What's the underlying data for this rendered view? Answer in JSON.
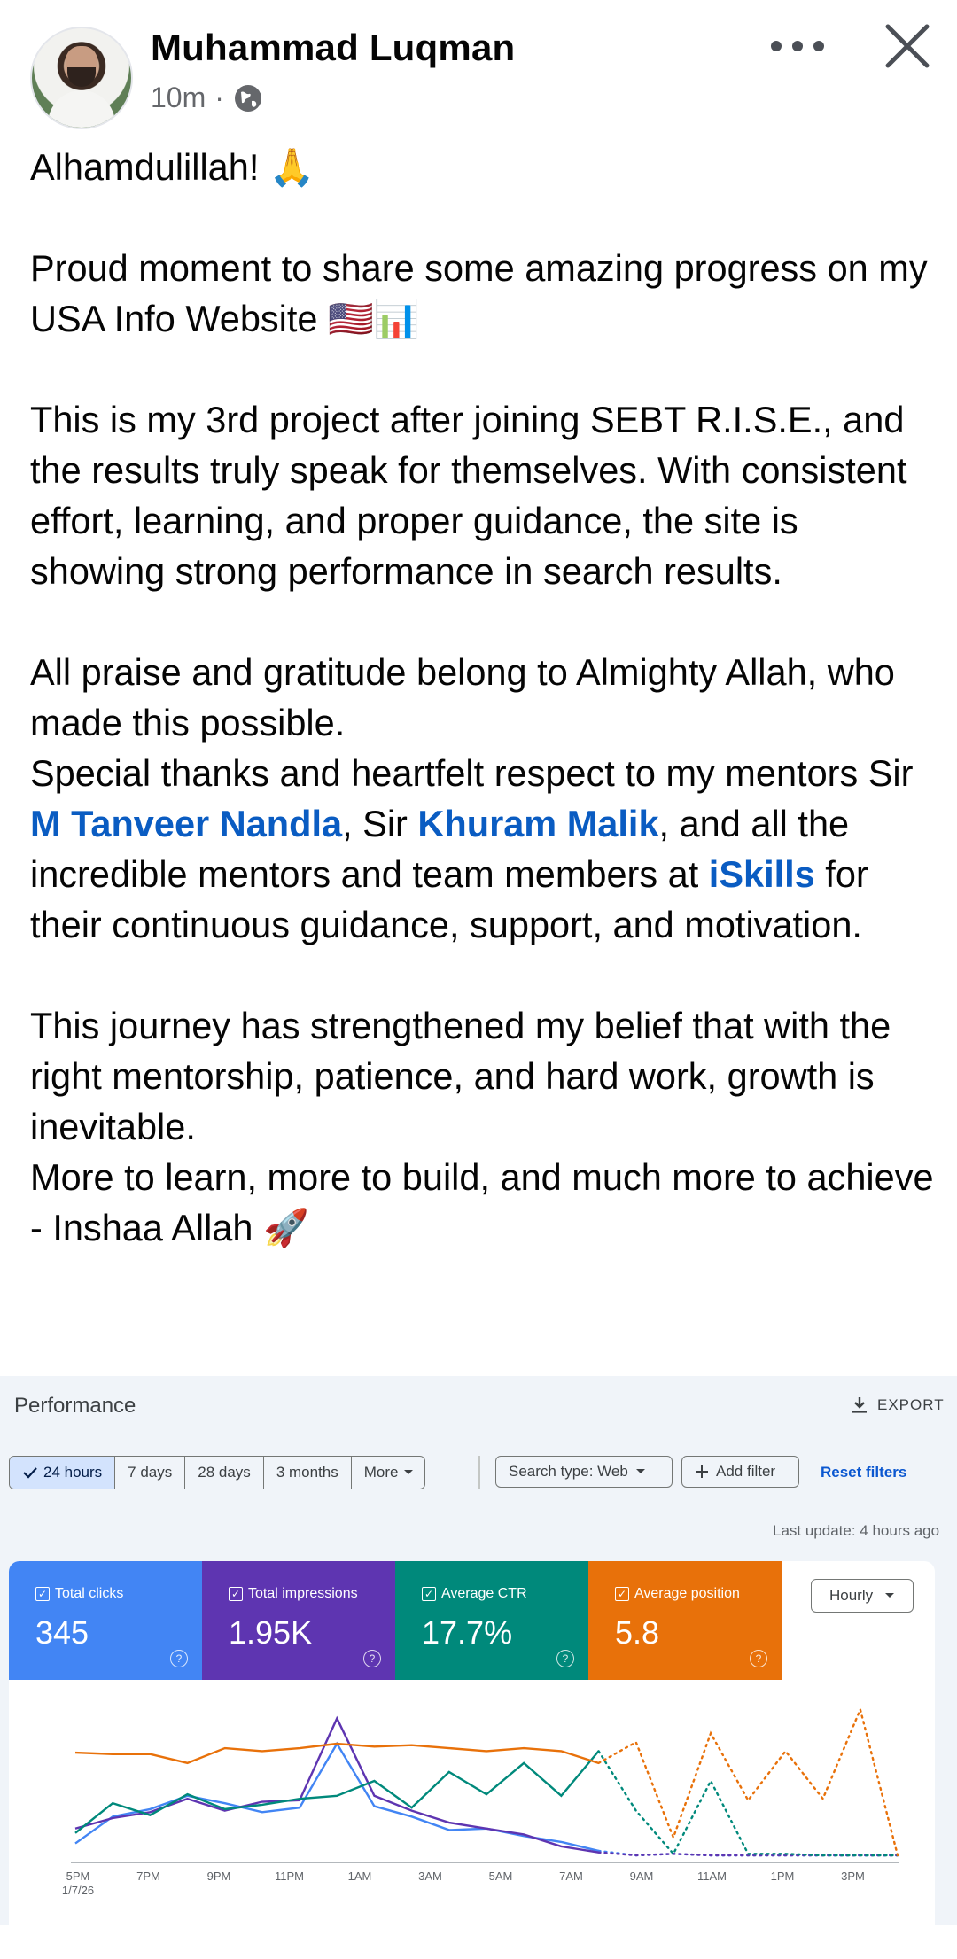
{
  "post": {
    "author": "Muhammad Luqman",
    "time": "10m",
    "separator": "·",
    "paragraphs": [
      [
        "Alhamdulillah! 🙏"
      ],
      [
        "Proud moment to share some amazing progress on my USA Info Website 🇺🇸📊"
      ],
      [
        "This is my 3rd project after joining SEBT R.I.S.E., and the results truly speak for themselves. With consistent effort, learning, and proper guidance, the site is showing strong performance in search results."
      ],
      [
        "All praise and gratitude belong to Almighty Allah, who made this possible."
      ]
    ],
    "thanks": {
      "prefix": "Special thanks and heartfelt respect to my mentors Sir ",
      "mention1": "M Tanveer Nandla",
      "mid": ", Sir ",
      "mention2": "Khuram Malik",
      "mid2": ", and all the incredible mentors and team members at ",
      "mention3": "iSkills",
      "suffix": " for their continuous guidance, support, and motivation."
    },
    "closing1": "This journey has strengthened my belief that with the right mentorship, patience, and hard work, growth is inevitable.",
    "closing2": "More to learn, more to build, and much more to achieve - Inshaa Allah 🚀"
  },
  "performance": {
    "title": "Performance",
    "export_label": "EXPORT",
    "date_ranges": [
      "24 hours",
      "7 days",
      "28 days",
      "3 months",
      "More"
    ],
    "active_range": "24 hours",
    "search_type": "Search type: Web",
    "add_filter": "Add filter",
    "reset_filters": "Reset filters",
    "last_update": "Last update: 4 hours ago",
    "granularity": "Hourly",
    "metrics": [
      {
        "label": "Total clicks",
        "value": "345",
        "color": "#4285f4"
      },
      {
        "label": "Total impressions",
        "value": "1.95K",
        "color": "#5e35b1"
      },
      {
        "label": "Average CTR",
        "value": "17.7%",
        "color": "#00897b"
      },
      {
        "label": "Average position",
        "value": "5.8",
        "color": "#e8710a"
      }
    ]
  },
  "chart_data": {
    "type": "line",
    "x": [
      "5PM",
      "7PM",
      "9PM",
      "11PM",
      "1AM",
      "3AM",
      "5AM",
      "7AM",
      "9AM",
      "11AM",
      "1PM",
      "3PM"
    ],
    "x_sublabel": "1/7/26",
    "series": [
      {
        "name": "Total clicks",
        "color": "#4285f4",
        "values": [
          0.08,
          0.26,
          0.31,
          0.4,
          0.35,
          0.29,
          0.32,
          0.75,
          0.33,
          0.26,
          0.17,
          0.18,
          0.13,
          0.09,
          0.03,
          0.0,
          0.01,
          0.0,
          0.0,
          0.0,
          0.0,
          0.0,
          0.0
        ]
      },
      {
        "name": "Total impressions",
        "color": "#5e35b1",
        "values": [
          0.18,
          0.25,
          0.29,
          0.38,
          0.3,
          0.36,
          0.37,
          0.92,
          0.4,
          0.3,
          0.22,
          0.18,
          0.14,
          0.06,
          0.02,
          0.0,
          0.01,
          0.0,
          0.0,
          0.0,
          0.0,
          0.0,
          0.0
        ]
      },
      {
        "name": "Average CTR",
        "color": "#00897b",
        "values": [
          0.15,
          0.35,
          0.27,
          0.41,
          0.31,
          0.34,
          0.38,
          0.4,
          0.5,
          0.32,
          0.56,
          0.41,
          0.62,
          0.4,
          0.7,
          0.3,
          0.01,
          0.5,
          0.01,
          0.01,
          0.0,
          0.0,
          0.0
        ]
      },
      {
        "name": "Average position",
        "color": "#e8710a",
        "values": [
          0.69,
          0.68,
          0.68,
          0.62,
          0.72,
          0.7,
          0.72,
          0.75,
          0.73,
          0.74,
          0.72,
          0.7,
          0.72,
          0.7,
          0.62,
          0.76,
          0.12,
          0.82,
          0.37,
          0.7,
          0.38,
          0.98,
          0.0
        ]
      }
    ],
    "dotted_from_index": 14,
    "ylim": [
      0,
      1
    ],
    "grid": false
  }
}
